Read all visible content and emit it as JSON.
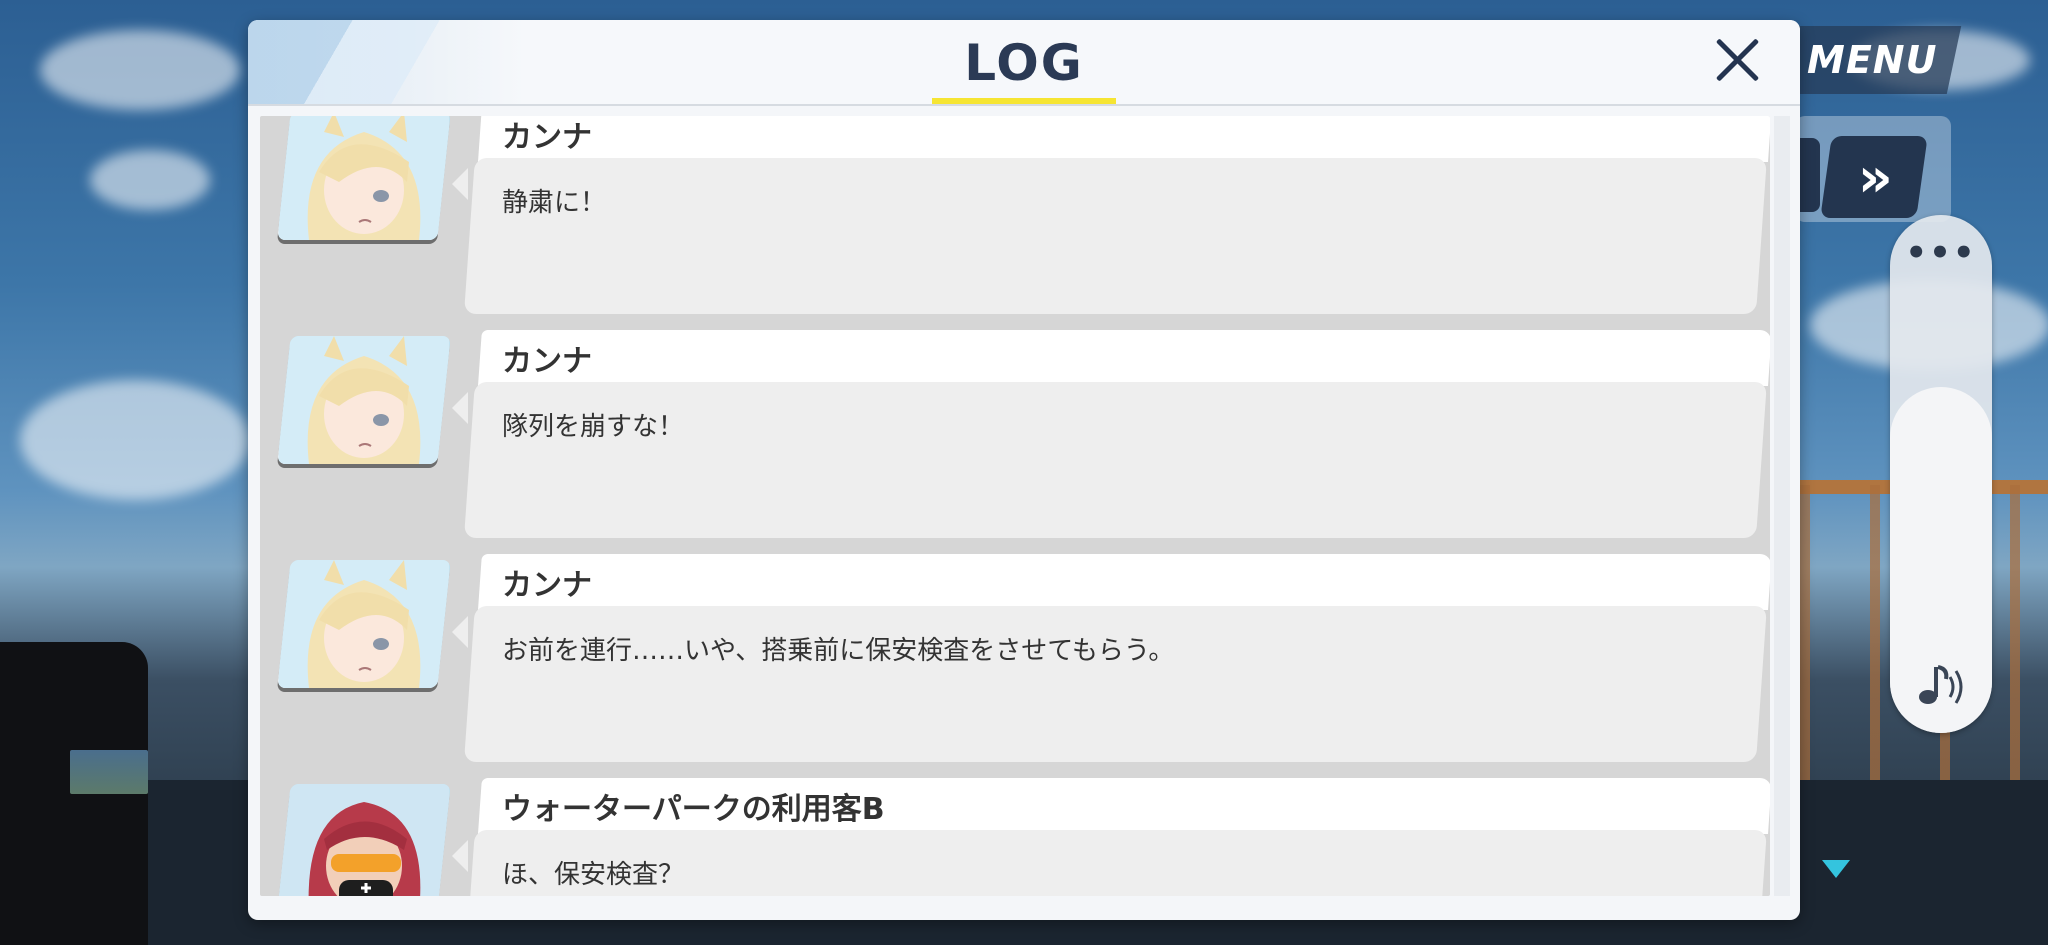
{
  "hud": {
    "menu_label": "MENU",
    "skip_glyph": "»",
    "more_glyph": "•••",
    "volume_icon": "music-note-volume-icon"
  },
  "log": {
    "title": "LOG",
    "close_icon": "close-icon",
    "entries": [
      {
        "speaker": "カンナ",
        "text": "静粛に！",
        "avatar": "kanna-portrait"
      },
      {
        "speaker": "カンナ",
        "text": "隊列を崩すな！",
        "avatar": "kanna-portrait"
      },
      {
        "speaker": "カンナ",
        "text": "お前を連行……いや、搭乗前に保安検査をさせてもらう。",
        "avatar": "kanna-portrait"
      },
      {
        "speaker": "ウォーターパークの利用客B",
        "text": "ほ、保安検査？",
        "avatar": "water-park-guest-portrait"
      }
    ]
  },
  "colors": {
    "accent_underline": "#f6e533",
    "title_navy": "#2b3a55",
    "hud_navy": "#23354f",
    "bubble": "#eeeeee"
  }
}
